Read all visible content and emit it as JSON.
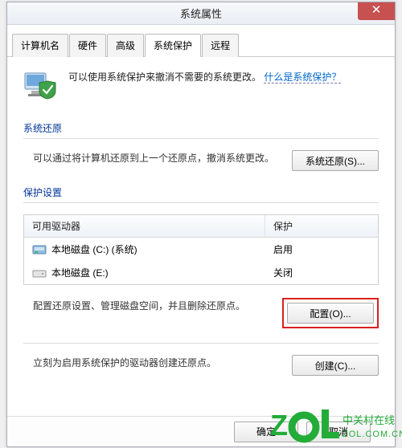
{
  "window": {
    "title": "系统属性"
  },
  "tabs": {
    "items": [
      {
        "label": "计算机名"
      },
      {
        "label": "硬件"
      },
      {
        "label": "高级"
      },
      {
        "label": "系统保护"
      },
      {
        "label": "远程"
      }
    ],
    "active_index": 3
  },
  "intro": {
    "text": "可以使用系统保护来撤消不需要的系统更改。",
    "link": "什么是系统保护？"
  },
  "restore_section": {
    "title": "系统还原",
    "desc": "可以通过将计算机还原到上一个还原点，撤消系统更改。",
    "button": "系统还原(S)..."
  },
  "protection_section": {
    "title": "保护设置",
    "columns": {
      "drive": "可用驱动器",
      "protection": "保护"
    },
    "drives": [
      {
        "icon": "hdd-system",
        "name": "本地磁盘 (C:) (系统)",
        "protection": "启用"
      },
      {
        "icon": "hdd",
        "name": "本地磁盘 (E:)",
        "protection": "关闭"
      }
    ],
    "configure": {
      "desc": "配置还原设置、管理磁盘空间，并且删除还原点。",
      "button": "配置(O)..."
    },
    "create": {
      "desc": "立刻为启用系统保护的驱动器创建还原点。",
      "button": "创建(C)..."
    }
  },
  "footer": {
    "ok": "确定",
    "cancel": "取消"
  },
  "watermark": {
    "text_cn": "中关村在线",
    "text_en": "ZOL.COM.CN"
  }
}
